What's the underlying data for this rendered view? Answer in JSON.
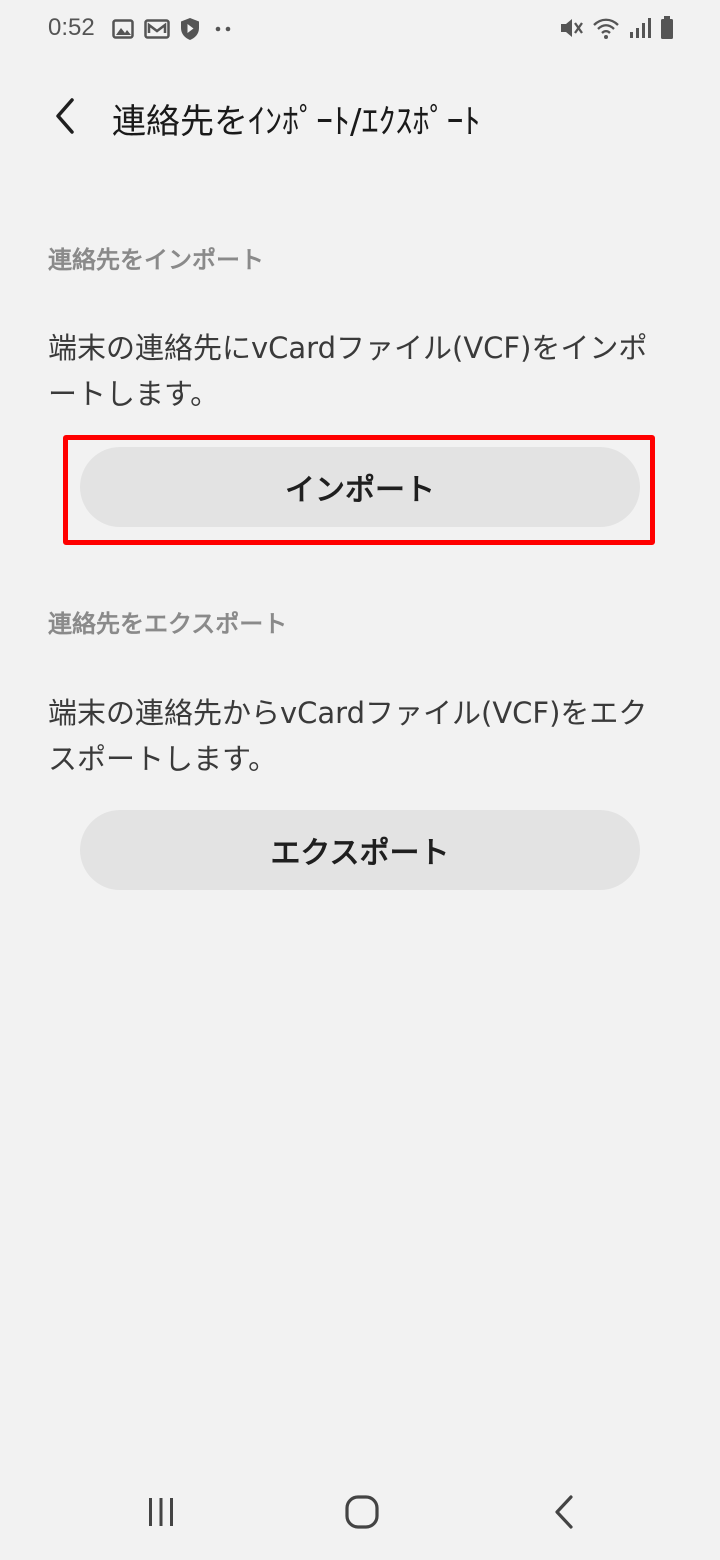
{
  "status_bar": {
    "time": "0:52",
    "left_icons": [
      "image-icon",
      "mail-icon",
      "shield-icon",
      "more-dots-icon"
    ],
    "right_icons": [
      "mute-icon",
      "wifi-icon",
      "signal-icon",
      "battery-icon"
    ]
  },
  "header": {
    "back_icon": "chevron-left-icon",
    "title": "連絡先をｲﾝﾎﾟｰﾄ/ｴｸｽﾎﾟｰﾄ"
  },
  "import_section": {
    "heading": "連絡先をインポート",
    "description": "端末の連絡先にvCardファイル(VCF)をインポートします。",
    "button_label": "インポート"
  },
  "export_section": {
    "heading": "連絡先をエクスポート",
    "description": "端末の連絡先からvCardファイル(VCF)をエクスポートします。",
    "button_label": "エクスポート"
  },
  "nav_bar": {
    "recents_icon": "recents-icon",
    "home_icon": "home-icon",
    "back_icon": "back-icon"
  },
  "colors": {
    "background": "#f2f2f2",
    "button": "#e3e3e3",
    "highlight": "#ff0000",
    "section_heading": "#8a8a8a"
  }
}
